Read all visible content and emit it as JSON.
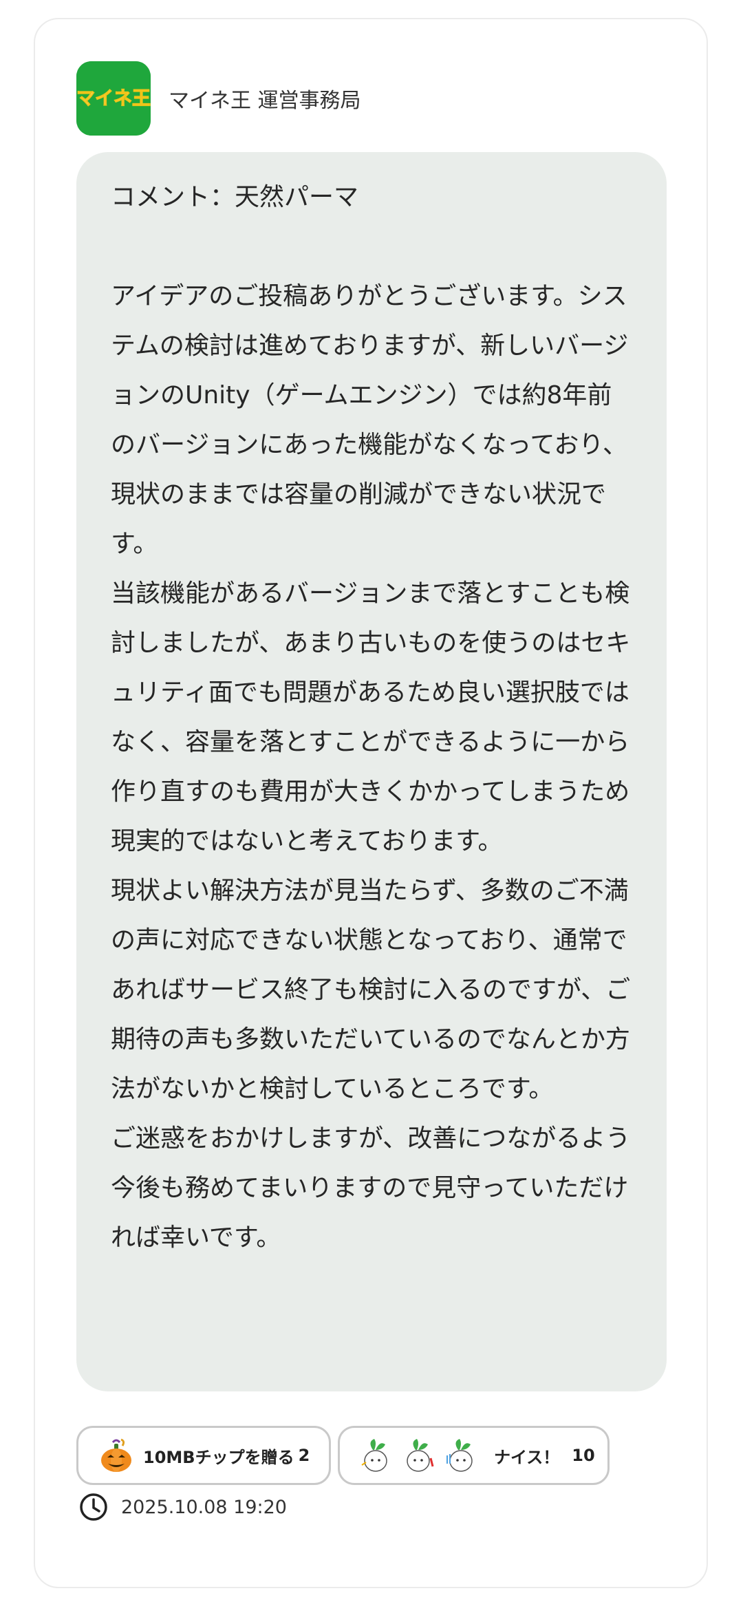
{
  "post": {
    "author": "マイネ王 運営事務局",
    "logo_text": "マイネ王",
    "comment_title": "コメント：天然パーマ",
    "paragraphs": [
      "アイデアのご投稿ありがとうございます。システムの検討は進めておりますが、新しいバージョンのUnity（ゲームエンジン）では約8年前のバージョンにあった機能がなくなっており、現状のままでは容量の削減ができない状況です。",
      "当該機能があるバージョンまで落とすことも検討しましたが、あまり古いものを使うのはセキュリティ面でも問題があるため良い選択肢ではなく、容量を落とすことができるように一から作り直すのも費用が大きくかかってしまうため現実的ではないと考えております。",
      "現状よい解決方法が見当たらず、多数のご不満の声に対応できない状態となっており、通常であればサービス終了も検討に入るのですが、ご期待の声も多数いただいているのでなんとか方法がないかと検討しているところです。",
      "ご迷惑をおかけしますが、改善につながるよう今後も務めてまいりますので見守っていただければ幸いです。"
    ]
  },
  "reactions": {
    "gift": {
      "label": "10MBチップを贈る",
      "count": "2",
      "icon": "pumpkin-icon"
    },
    "nice": {
      "label": "ナイス！",
      "count": "10",
      "icon": "radish-mascot-icon"
    }
  },
  "timestamp": {
    "value": "2025.10.08 19:20",
    "icon": "clock-icon"
  },
  "colors": {
    "logo_green": "#1fa73c",
    "bubble_bg": "#e9edea",
    "chip_border": "#c9c9c9"
  }
}
